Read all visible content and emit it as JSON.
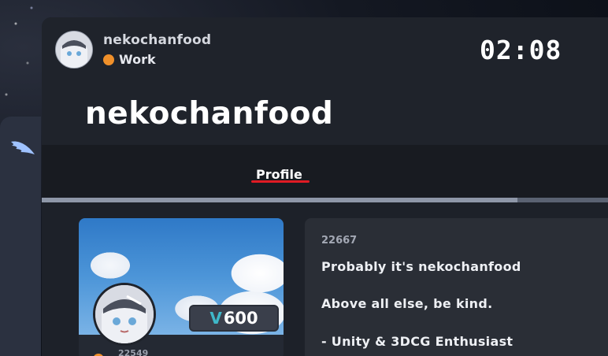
{
  "header": {
    "username": "nekochanfood",
    "status": {
      "label": "Work",
      "color": "#f0902a"
    },
    "clock": "02:08",
    "title": "nekochanfood"
  },
  "tabs": [
    {
      "label": "Profile",
      "active": true
    }
  ],
  "progress": {
    "fraction": 0.84
  },
  "profile_card": {
    "price_value": "600",
    "price_icon": "currency-v-icon",
    "id_text": "22549"
  },
  "profile_panel": {
    "id": "22667",
    "bio_lines": [
      "Probably it's nekochanfood",
      "Above all else, be kind.",
      "- Unity & 3DCG Enthusiast"
    ]
  },
  "colors": {
    "accent_red": "#e01b24",
    "status_orange": "#f0902a",
    "price_cyan": "#3fb8c9"
  },
  "icons": {
    "rail": "wing-icon",
    "avatar": "avatar"
  }
}
